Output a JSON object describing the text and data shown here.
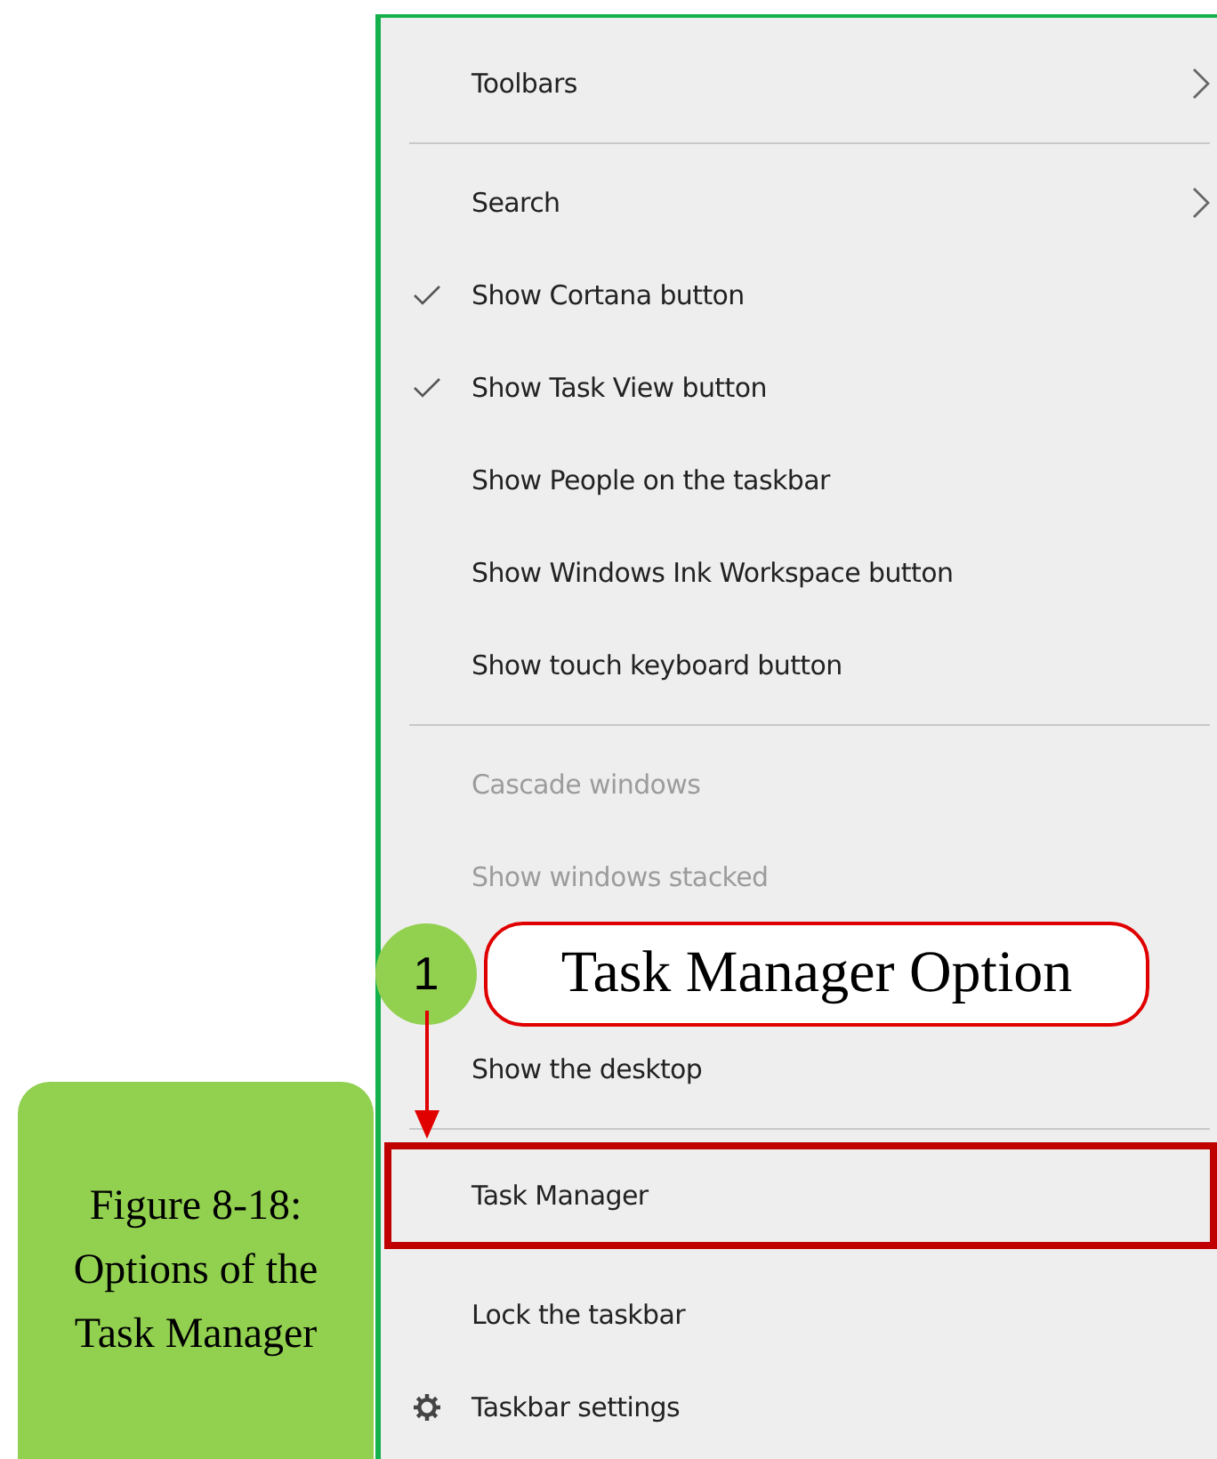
{
  "menu": {
    "items": [
      {
        "kind": "item",
        "label": "Toolbars",
        "submenu": true,
        "checked": false,
        "disabled": false,
        "highlighted": false
      },
      {
        "kind": "divider"
      },
      {
        "kind": "item",
        "label": "Search",
        "submenu": true,
        "checked": false,
        "disabled": false,
        "highlighted": false
      },
      {
        "kind": "item",
        "label": "Show Cortana button",
        "submenu": false,
        "checked": true,
        "disabled": false,
        "highlighted": false
      },
      {
        "kind": "item",
        "label": "Show Task View button",
        "submenu": false,
        "checked": true,
        "disabled": false,
        "highlighted": false
      },
      {
        "kind": "item",
        "label": "Show People on the taskbar",
        "submenu": false,
        "checked": false,
        "disabled": false,
        "highlighted": false
      },
      {
        "kind": "item",
        "label": "Show Windows Ink Workspace button",
        "submenu": false,
        "checked": false,
        "disabled": false,
        "highlighted": false
      },
      {
        "kind": "item",
        "label": "Show touch keyboard button",
        "submenu": false,
        "checked": false,
        "disabled": false,
        "highlighted": false
      },
      {
        "kind": "divider"
      },
      {
        "kind": "item",
        "label": "Cascade windows",
        "submenu": false,
        "checked": false,
        "disabled": true,
        "highlighted": false
      },
      {
        "kind": "item",
        "label": "Show windows stacked",
        "submenu": false,
        "checked": false,
        "disabled": true,
        "highlighted": false
      },
      {
        "kind": "callout",
        "number": "1",
        "label": "Task Manager Option"
      },
      {
        "kind": "item",
        "label": "Show the desktop",
        "submenu": false,
        "checked": false,
        "disabled": false,
        "highlighted": false
      },
      {
        "kind": "divider"
      },
      {
        "kind": "item",
        "label": "Task Manager",
        "submenu": false,
        "checked": false,
        "disabled": false,
        "highlighted": true
      },
      {
        "kind": "item",
        "label": "Lock the taskbar",
        "submenu": false,
        "checked": false,
        "disabled": false,
        "highlighted": false
      },
      {
        "kind": "settings",
        "label": "Taskbar settings"
      }
    ]
  },
  "caption": {
    "lines": [
      "Figure 8-18:",
      "Options of the",
      "Task Manager"
    ]
  }
}
